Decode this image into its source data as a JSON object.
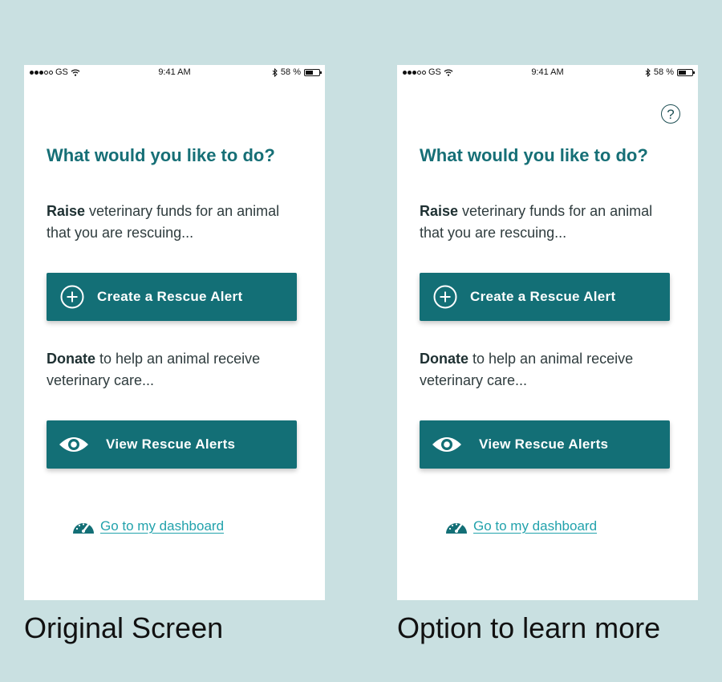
{
  "status_bar": {
    "carrier": "GS",
    "time": "9:41 AM",
    "battery_text": "58 %",
    "battery_level": 0.58
  },
  "screen": {
    "title": "What would you like to do?",
    "raise_bold": "Raise",
    "raise_rest": " veterinary funds for an animal that you are rescuing...",
    "create_button": "Create a Rescue Alert",
    "donate_bold": "Donate",
    "donate_rest": " to help an animal receive veterinary care...",
    "view_button": "View Rescue Alerts",
    "dashboard_link": "Go to my dashboard",
    "help_symbol": "?"
  },
  "captions": {
    "left": "Original Screen",
    "right": "Option to learn more"
  },
  "icons": {
    "create": "plus-circle-icon",
    "view": "eye-icon",
    "dashboard": "speedometer-icon",
    "help": "question-circle-icon"
  },
  "colors": {
    "background": "#c9e0e1",
    "primary": "#136f76",
    "title": "#166f76",
    "link": "#22a2ac"
  }
}
